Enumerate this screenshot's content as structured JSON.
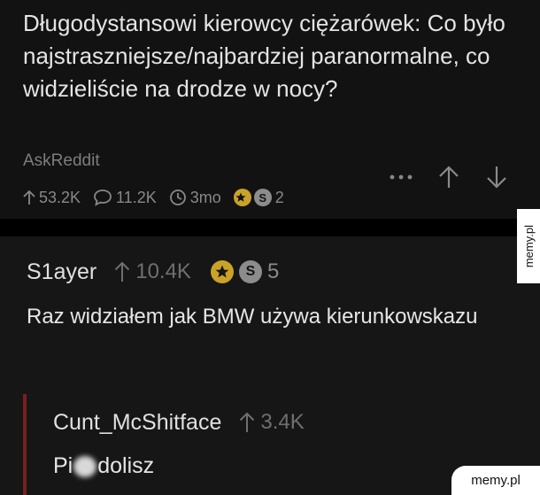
{
  "post": {
    "title": "Długodystansowi kierowcy ciężarówek: Co było najstraszniejsze/najbardziej paranormalne, co widzieliście na drodze w nocy?",
    "subreddit": "AskReddit",
    "upvotes": "53.2K",
    "comments": "11.2K",
    "age": "3mo",
    "award_count": "2"
  },
  "comment": {
    "author": "S1ayer",
    "score": "10.4K",
    "award_count": "5",
    "body": "Raz widziałem jak BMW używa kierunkowskazu"
  },
  "reply": {
    "author": "Cunt_McShitface",
    "score": "3.4K",
    "body_start": "Pi",
    "body_end": "dolisz"
  },
  "watermark": {
    "side": "memy.pl",
    "bottom": "memy.pl"
  },
  "colors": {
    "background": "#121212",
    "gold_award": "#c9a227",
    "reply_thread_line": "#7a1f1f"
  }
}
